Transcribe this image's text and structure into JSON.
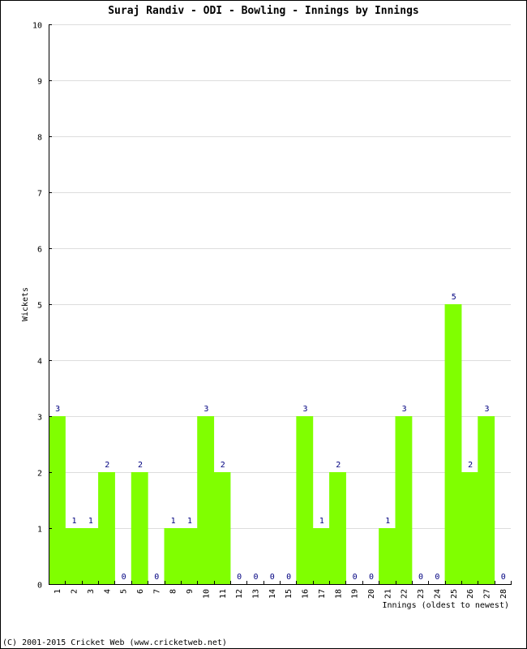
{
  "chart_data": {
    "type": "bar",
    "title": "Suraj Randiv - ODI - Bowling - Innings by Innings",
    "xlabel": "Innings (oldest to newest)",
    "ylabel": "Wickets",
    "ylim": [
      0,
      10
    ],
    "yticks": [
      "0",
      "1",
      "2",
      "3",
      "4",
      "5",
      "6",
      "7",
      "8",
      "9",
      "10"
    ],
    "grid": true,
    "categories": [
      "1",
      "2",
      "3",
      "4",
      "5",
      "6",
      "7",
      "8",
      "9",
      "10",
      "11",
      "12",
      "13",
      "14",
      "15",
      "16",
      "17",
      "18",
      "19",
      "20",
      "21",
      "22",
      "23",
      "24",
      "25",
      "26",
      "27",
      "28"
    ],
    "values": [
      3,
      1,
      1,
      2,
      0,
      2,
      0,
      1,
      1,
      3,
      2,
      0,
      0,
      0,
      0,
      3,
      1,
      2,
      0,
      0,
      1,
      3,
      0,
      0,
      5,
      2,
      3,
      0
    ],
    "bar_color": "#80ff00",
    "label_color": "#000080",
    "grid_color": "#dddddd"
  },
  "footer": "(C) 2001-2015 Cricket Web (www.cricketweb.net)"
}
